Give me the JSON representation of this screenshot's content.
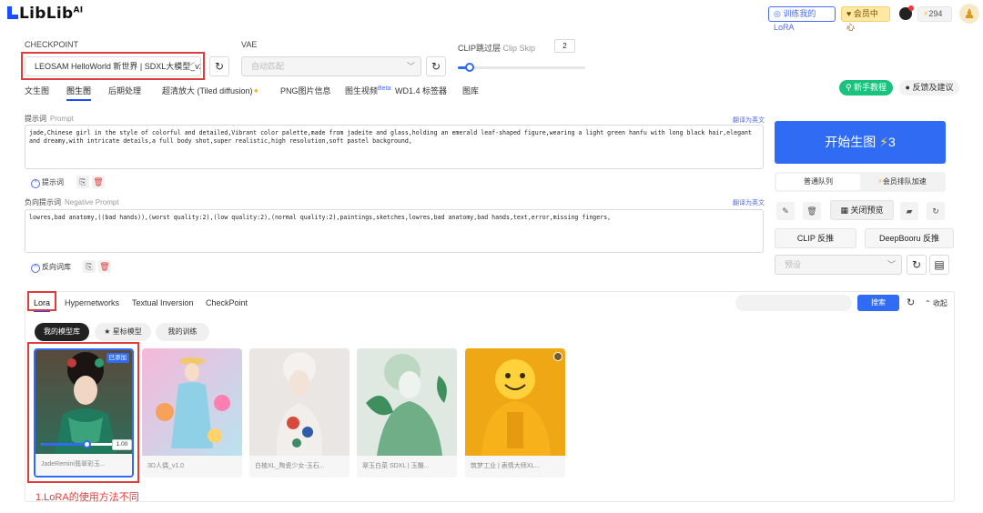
{
  "header": {
    "logo": "LibLib",
    "logo_sup": "AI",
    "train_lora": "训练我的LoRA",
    "vip_center": "会员中心",
    "points": "294"
  },
  "checkpoint": {
    "label": "CHECKPOINT",
    "value": "LEOSAM HelloWorld 新世界 | SDXL大模型_v2.s",
    "vae_label": "VAE",
    "vae_value": "自动匹配",
    "clip_label": "CLIP跳过层",
    "clip_label_en": "Clip Skip",
    "clip_value": "2",
    "clip_level": 0.09
  },
  "tabs": [
    "文生图",
    "图生图",
    "后期处理",
    "超清放大 (Tiled diffusion)",
    "PNG图片信息",
    "图生视频",
    "WD1.4 标签器",
    "图库"
  ],
  "tab_beta": "Beta",
  "actions": {
    "tutorial": "新手教程",
    "feedback": "反馈及建议"
  },
  "prompt": {
    "label": "提示词",
    "label_en": "Prompt",
    "translate": "翻译为英文",
    "text": "jade,Chinese girl in the style of colorful and detailed,Vibrant color palette,made from jadeite and glass,holding an emerald leaf-shaped figure,wearing a light green hanfu with long black hair,elegant and dreamy,with intricate details,a full body shot,super realistic,high resolution,soft pastel background,",
    "library": "提示词"
  },
  "negative": {
    "label": "负向提示词",
    "label_en": "Negative Prompt",
    "translate": "翻译为英文",
    "text": "lowres,bad anatomy,((bad hands)),(worst quality:2),(low quality:2),(normal quality:2),paintings,sketches,lowres,bad anatomy,bad hands,text,error,missing fingers,",
    "library": "反向词库"
  },
  "generate": {
    "label": "开始生图",
    "cost": "3",
    "queue_normal": "普通队列",
    "queue_vip": "会员排队加速",
    "close_preview": "关闭预览",
    "clip_reverse": "CLIP 反推",
    "deepbooru": "DeepBooru 反推",
    "preset_placeholder": "预设"
  },
  "lora": {
    "tabs": [
      "Lora",
      "Hypernetworks",
      "Textual Inversion",
      "CheckPoint"
    ],
    "search_btn": "搜索",
    "collapse": "收起",
    "chips": [
      "我的模型库",
      "星标模型",
      "我的训练"
    ],
    "added_badge": "已添加",
    "weight": "1.00",
    "weight_level": 0.62,
    "cards": [
      {
        "caption": "JadeRemini翡翠彩玉..."
      },
      {
        "caption": "3D人偶_v1.0"
      },
      {
        "caption": "白棱XL_陶瓷少女-玉石..."
      },
      {
        "caption": "翠玉白菜 SDXL | 玉雕..."
      },
      {
        "caption": "筑梦工业 | 表情大师XL..."
      }
    ]
  },
  "annotation": "1.LoRA的使用方法不同",
  "colors": {
    "accent": "#2f6bf3",
    "red_annotation": "#e23b3b",
    "green": "#19c37d"
  }
}
